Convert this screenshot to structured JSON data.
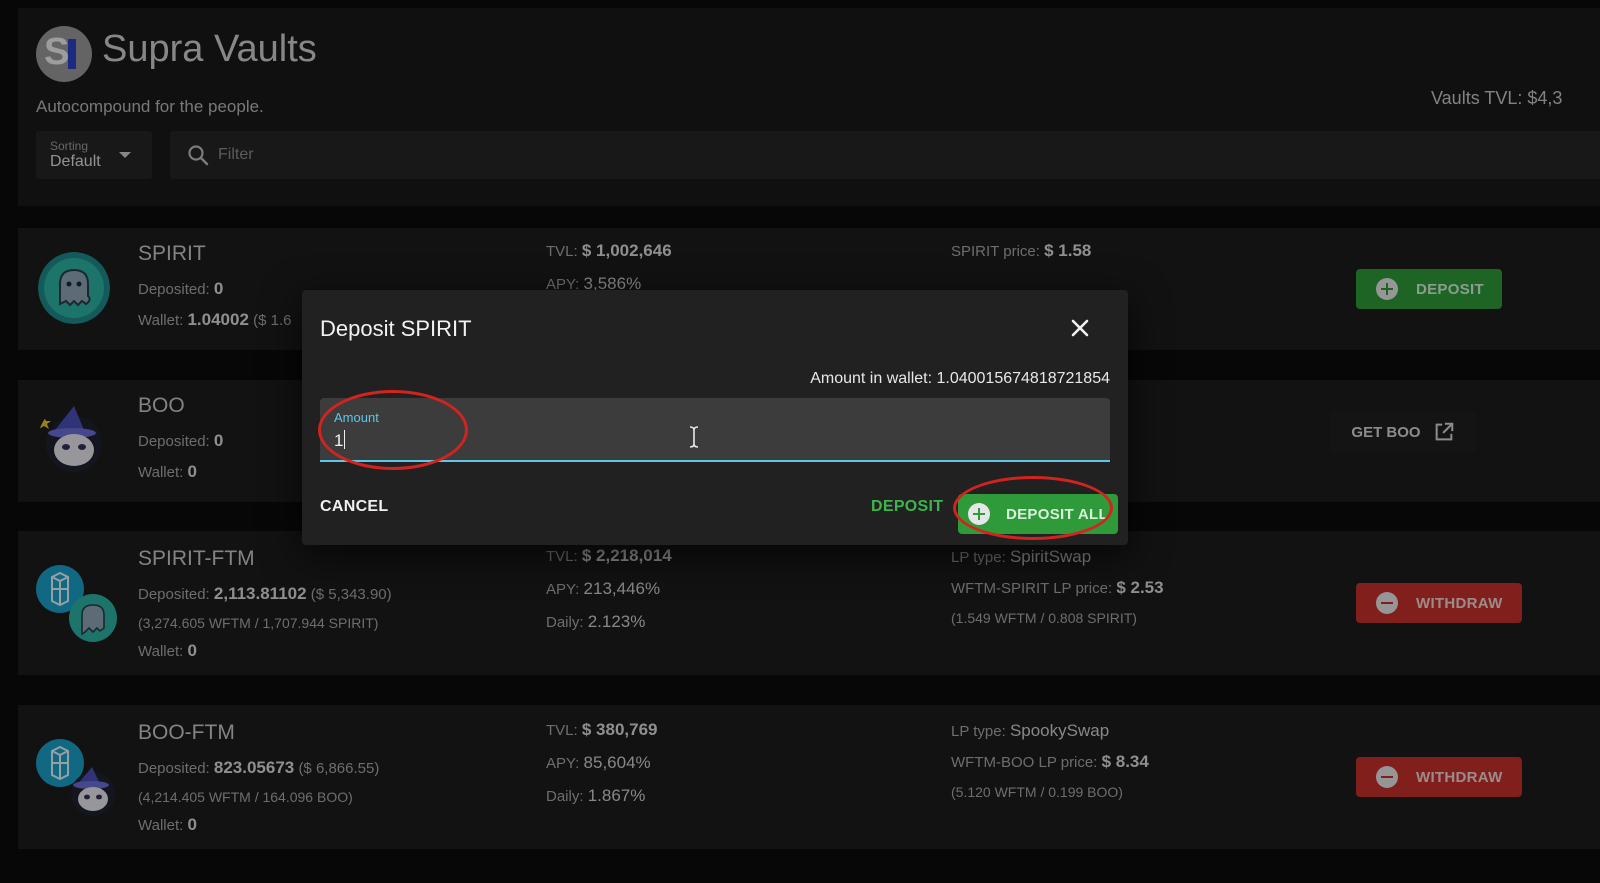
{
  "header": {
    "title": "Supra Vaults",
    "tagline": "Autocompound for the people.",
    "tvl_total": "Vaults TVL: $4,3",
    "sorting_label": "Sorting",
    "sorting_value": "Default",
    "filter_placeholder": "Filter"
  },
  "vaults": [
    {
      "name": "SPIRIT",
      "deposited_label": "Deposited:",
      "deposited": "0",
      "wallet_label": "Wallet:",
      "wallet": "1.04002",
      "wallet_usd": "($ 1.6",
      "tvl_label": "TVL:",
      "tvl": "$ 1,002,646",
      "apy_label": "APY:",
      "apy": "3,586%",
      "price_label": "SPIRIT price:",
      "price": "$ 1.58",
      "action": "DEPOSIT"
    },
    {
      "name": "BOO",
      "deposited_label": "Deposited:",
      "deposited": "0",
      "wallet_label": "Wallet:",
      "wallet": "0",
      "action": "GET BOO"
    },
    {
      "name": "SPIRIT-FTM",
      "deposited_label": "Deposited:",
      "deposited": "2,113.81102",
      "deposited_usd": "($ 5,343.90)",
      "breakdown": "(3,274.605 WFTM / 1,707.944 SPIRIT)",
      "wallet_label": "Wallet:",
      "wallet": "0",
      "tvl_label": "TVL:",
      "tvl": "$ 2,218,014",
      "apy_label": "APY:",
      "apy": "213,446%",
      "daily_label": "Daily:",
      "daily": "2.123%",
      "lp_type_label": "LP type:",
      "lp_type": "SpiritSwap",
      "lp_price_label": "WFTM-SPIRIT LP price:",
      "lp_price": "$ 2.53",
      "lp_breakdown": "(1.549 WFTM / 0.808 SPIRIT)",
      "action": "WITHDRAW"
    },
    {
      "name": "BOO-FTM",
      "deposited_label": "Deposited:",
      "deposited": "823.05673",
      "deposited_usd": "($ 6,866.55)",
      "breakdown": "(4,214.405 WFTM / 164.096 BOO)",
      "wallet_label": "Wallet:",
      "wallet": "0",
      "tvl_label": "TVL:",
      "tvl": "$ 380,769",
      "apy_label": "APY:",
      "apy": "85,604%",
      "daily_label": "Daily:",
      "daily": "1.867%",
      "lp_type_label": "LP type:",
      "lp_type": "SpookySwap",
      "lp_price_label": "WFTM-BOO LP price:",
      "lp_price": "$ 8.34",
      "lp_breakdown": "(5.120 WFTM / 0.199 BOO)",
      "action": "WITHDRAW"
    }
  ],
  "dialog": {
    "title": "Deposit SPIRIT",
    "wallet_amount": "Amount in wallet: 1.040015674818721854",
    "amount_label": "Amount",
    "amount_value": "1",
    "cancel_label": "CANCEL",
    "deposit_label": "DEPOSIT",
    "deposit_all_label": "DEPOSIT ALL"
  },
  "icons": {
    "search": "search-icon",
    "dropdown": "chevron-down-icon",
    "close": "close-icon",
    "external_link": "external-link-icon",
    "plus": "plus-circle-icon",
    "minus": "minus-circle-icon"
  },
  "colors": {
    "accent_green": "#2e9a3a",
    "danger_red": "#c6302c",
    "input_focus": "#5ec7e8",
    "annotation_red": "#d2231f"
  }
}
